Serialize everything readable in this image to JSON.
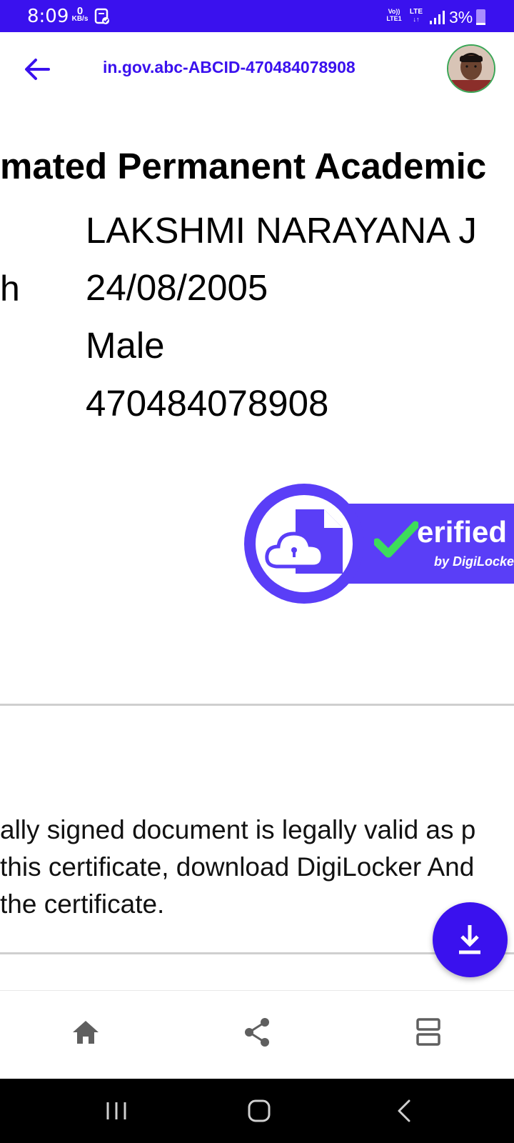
{
  "status_bar": {
    "time": "8:09",
    "net_speed_value": "0",
    "net_speed_unit": "KB/s",
    "volte_top": "Vo))",
    "volte_bottom": "LTE1",
    "lte": "LTE",
    "battery": "3%",
    "colors": {
      "background": "#3a11ee"
    }
  },
  "app_bar": {
    "title": "in.gov.abc-ABCID-470484078908",
    "back_icon": "arrow-left-icon",
    "avatar": "profile-photo"
  },
  "document": {
    "heading": "mated Permanent Academic",
    "label_fragment": "h",
    "name": "LAKSHMI NARAYANA J",
    "dob": "24/08/2005",
    "gender": "Male",
    "id": "470484078908"
  },
  "badge": {
    "word": "erified",
    "sub": "by DigiLocker",
    "colors": {
      "purple": "#5a3ef7",
      "check": "#3ddc5a"
    }
  },
  "note": {
    "line1": "ally signed document is legally valid as p",
    "line2": "this certificate, download DigiLocker And",
    "line3": "the certificate."
  },
  "fab": {
    "icon": "download-icon",
    "color": "#3a11ee"
  },
  "bottom_nav": {
    "items": [
      {
        "icon": "home-icon"
      },
      {
        "icon": "share-icon"
      },
      {
        "icon": "details-icon"
      }
    ]
  },
  "system_nav": {
    "items": [
      {
        "icon": "recent-apps-icon"
      },
      {
        "icon": "home-circle-icon"
      },
      {
        "icon": "back-chevron-icon"
      }
    ]
  }
}
